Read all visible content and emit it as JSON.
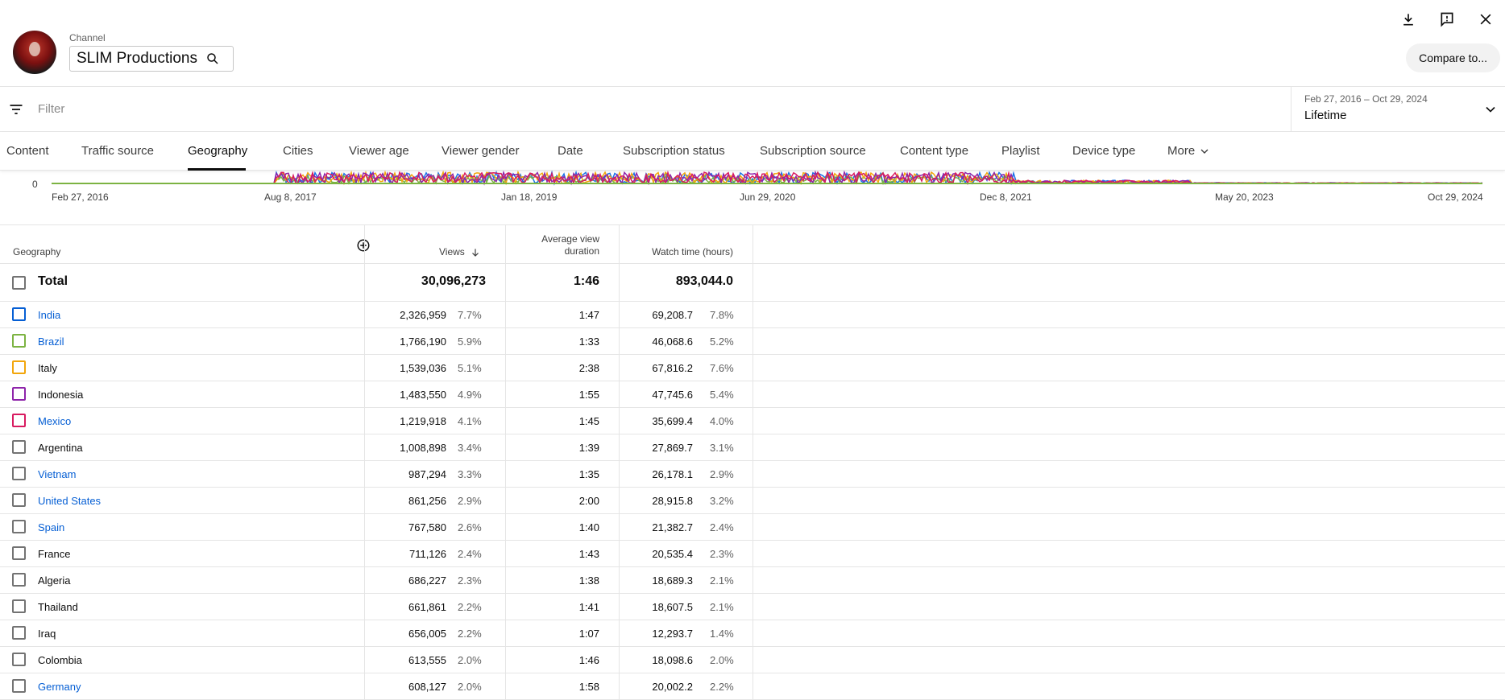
{
  "header": {
    "channel_label": "Channel",
    "channel_name": "SLIM Productions",
    "compare_label": "Compare to..."
  },
  "filter": {
    "placeholder": "Filter",
    "date_range": "Feb 27, 2016 – Oct 29, 2024",
    "date_selection": "Lifetime"
  },
  "tabs": [
    {
      "label": "Content"
    },
    {
      "label": "Traffic source"
    },
    {
      "label": "Geography"
    },
    {
      "label": "Cities"
    },
    {
      "label": "Viewer age"
    },
    {
      "label": "Viewer gender"
    },
    {
      "label": "Date"
    },
    {
      "label": "Subscription status"
    },
    {
      "label": "Subscription source"
    },
    {
      "label": "Content type"
    },
    {
      "label": "Playlist"
    },
    {
      "label": "Device type"
    },
    {
      "label": "More"
    }
  ],
  "active_tab": "Geography",
  "chart": {
    "zero_label": "0",
    "x_ticks": [
      "Feb 27, 2016",
      "Aug 8, 2017",
      "Jan 18, 2019",
      "Jun 29, 2020",
      "Dec 8, 2021",
      "May 20, 2023",
      "Oct 29, 2024"
    ],
    "series_colors": [
      "#1a73e8",
      "#7cb342",
      "#f2a60c",
      "#8e24aa",
      "#d81b60"
    ]
  },
  "table": {
    "headers": {
      "geography": "Geography",
      "views": "Views",
      "avg_line1": "Average view",
      "avg_line2": "duration",
      "watch": "Watch time (hours)"
    },
    "total": {
      "label": "Total",
      "views": "30,096,273",
      "avg": "1:46",
      "watch": "893,044.0"
    },
    "rows": [
      {
        "name": "India",
        "link": true,
        "color": "#065fd4",
        "views": "2,326,959",
        "vpct": "7.7%",
        "avg": "1:47",
        "watch": "69,208.7",
        "wpct": "7.8%"
      },
      {
        "name": "Brazil",
        "link": true,
        "color": "#7cb342",
        "views": "1,766,190",
        "vpct": "5.9%",
        "avg": "1:33",
        "watch": "46,068.6",
        "wpct": "5.2%"
      },
      {
        "name": "Italy",
        "link": false,
        "color": "#f2a60c",
        "views": "1,539,036",
        "vpct": "5.1%",
        "avg": "2:38",
        "watch": "67,816.2",
        "wpct": "7.6%"
      },
      {
        "name": "Indonesia",
        "link": false,
        "color": "#8e24aa",
        "views": "1,483,550",
        "vpct": "4.9%",
        "avg": "1:55",
        "watch": "47,745.6",
        "wpct": "5.4%"
      },
      {
        "name": "Mexico",
        "link": true,
        "color": "#d81b60",
        "views": "1,219,918",
        "vpct": "4.1%",
        "avg": "1:45",
        "watch": "35,699.4",
        "wpct": "4.0%"
      },
      {
        "name": "Argentina",
        "link": false,
        "color": "#737373",
        "views": "1,008,898",
        "vpct": "3.4%",
        "avg": "1:39",
        "watch": "27,869.7",
        "wpct": "3.1%"
      },
      {
        "name": "Vietnam",
        "link": true,
        "color": "#737373",
        "views": "987,294",
        "vpct": "3.3%",
        "avg": "1:35",
        "watch": "26,178.1",
        "wpct": "2.9%"
      },
      {
        "name": "United States",
        "link": true,
        "color": "#737373",
        "views": "861,256",
        "vpct": "2.9%",
        "avg": "2:00",
        "watch": "28,915.8",
        "wpct": "3.2%"
      },
      {
        "name": "Spain",
        "link": true,
        "color": "#737373",
        "views": "767,580",
        "vpct": "2.6%",
        "avg": "1:40",
        "watch": "21,382.7",
        "wpct": "2.4%"
      },
      {
        "name": "France",
        "link": false,
        "color": "#737373",
        "views": "711,126",
        "vpct": "2.4%",
        "avg": "1:43",
        "watch": "20,535.4",
        "wpct": "2.3%"
      },
      {
        "name": "Algeria",
        "link": false,
        "color": "#737373",
        "views": "686,227",
        "vpct": "2.3%",
        "avg": "1:38",
        "watch": "18,689.3",
        "wpct": "2.1%"
      },
      {
        "name": "Thailand",
        "link": false,
        "color": "#737373",
        "views": "661,861",
        "vpct": "2.2%",
        "avg": "1:41",
        "watch": "18,607.5",
        "wpct": "2.1%"
      },
      {
        "name": "Iraq",
        "link": false,
        "color": "#737373",
        "views": "656,005",
        "vpct": "2.2%",
        "avg": "1:07",
        "watch": "12,293.7",
        "wpct": "1.4%"
      },
      {
        "name": "Colombia",
        "link": false,
        "color": "#737373",
        "views": "613,555",
        "vpct": "2.0%",
        "avg": "1:46",
        "watch": "18,098.6",
        "wpct": "2.0%"
      },
      {
        "name": "Germany",
        "link": true,
        "color": "#737373",
        "views": "608,127",
        "vpct": "2.0%",
        "avg": "1:58",
        "watch": "20,002.2",
        "wpct": "2.2%"
      }
    ]
  }
}
